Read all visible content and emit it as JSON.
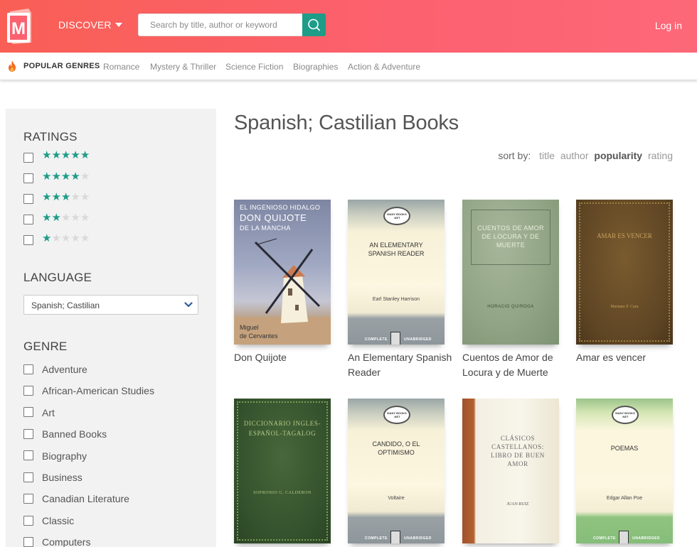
{
  "header": {
    "logo_letter": "M",
    "discover_label": "DISCOVER",
    "search_placeholder": "Search by title, author or keyword",
    "login_label": "Log in",
    "brand_color": "#fc6170",
    "accent_color": "#1e9c88"
  },
  "genre_bar": {
    "label": "POPULAR GENRES",
    "links": [
      "Romance",
      "Mystery & Thriller",
      "Science Fiction",
      "Biographies",
      "Action & Adventure"
    ]
  },
  "sidebar": {
    "ratings_heading": "RATINGS",
    "ratings": [
      5,
      4,
      3,
      2,
      1
    ],
    "language_heading": "LANGUAGE",
    "language_selected": "Spanish; Castilian",
    "genre_heading": "GENRE",
    "genres": [
      "Adventure",
      "African-American Studies",
      "Art",
      "Banned Books",
      "Biography",
      "Business",
      "Canadian Literature",
      "Classic",
      "Computers"
    ]
  },
  "main": {
    "title": "Spanish; Castilian Books",
    "sort": {
      "label": "sort by:",
      "options": [
        "title",
        "author",
        "popularity",
        "rating"
      ],
      "active": "popularity"
    },
    "books": [
      {
        "title": "Don Quijote",
        "cover": {
          "line1": "EL INGENIOSO HIDALGO",
          "line2": "DON QUIJOTE",
          "line3": "DE LA MANCHA",
          "author_line1": "Miguel",
          "author_line2": "de Cervantes"
        }
      },
      {
        "title": "An Elementary Spanish Reader",
        "cover": {
          "badge": "MANY BOOKS .NET",
          "title": "AN ELEMENTARY SPANISH READER",
          "author": "Earl Stanley Harrison",
          "foot_left": "COMPLETE",
          "foot_right": "UNABRIDGED"
        }
      },
      {
        "title": "Cuentos de Amor de Locura y de Muerte",
        "cover": {
          "title": "CUENTOS DE AMOR DE LOCURA Y DE MUERTE",
          "author": "HORACIO QUIROGA"
        }
      },
      {
        "title": "Amar es vencer",
        "cover": {
          "title": "AMAR ES VENCER",
          "author": "Mariano F. Cara"
        }
      },
      {
        "title": "",
        "cover": {
          "title": "DICCIONARIO INGLES-ESPAÑOL-TAGALOG",
          "author": "SOFRONIO G. CALDERON"
        }
      },
      {
        "title": "",
        "cover": {
          "badge": "MANY BOOKS .NET",
          "title": "CANDIDO, O EL OPTIMISMO",
          "author": "Voltaire",
          "foot_left": "COMPLETE",
          "foot_right": "UNABRIDGED"
        }
      },
      {
        "title": "",
        "cover": {
          "title": "CLÁSICOS CASTELLANOS: LIBRO DE BUEN AMOR",
          "author": "JUAN RUIZ"
        }
      },
      {
        "title": "",
        "cover": {
          "badge": "MANY BOOKS .NET",
          "title": "POEMAS",
          "author": "Edgar Allan Poe",
          "foot_left": "COMPLETE",
          "foot_right": "UNABRIDGED"
        }
      }
    ]
  }
}
